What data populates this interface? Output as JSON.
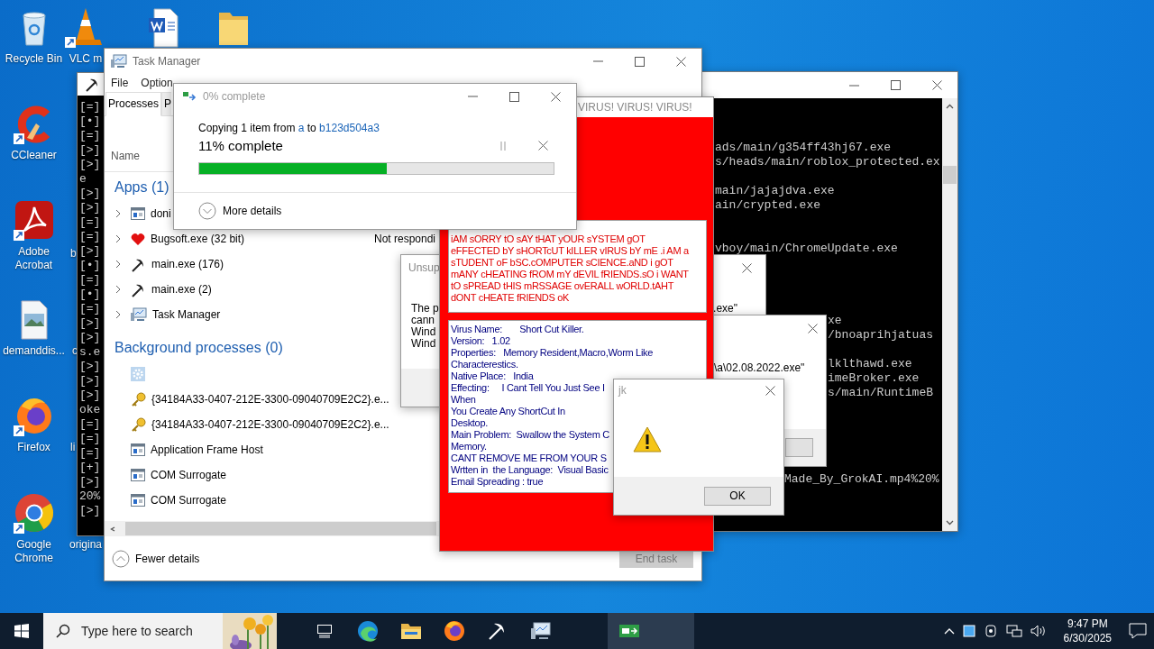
{
  "desktop": {
    "icons": [
      {
        "kind": "recycle-bin",
        "label": "Recycle Bin"
      },
      {
        "kind": "vlc",
        "label": "VLC m"
      },
      {
        "kind": "word-document"
      },
      {
        "kind": "folder"
      },
      {
        "kind": "ccleaner",
        "label": "CCleaner"
      },
      {
        "kind": "acrobat",
        "label": "Adobe Acrobat"
      },
      {
        "kind": "image-file",
        "label": "demanddis..."
      },
      {
        "kind": "firefox",
        "label": "Firefox"
      },
      {
        "kind": "chrome",
        "label": "Google Chrome"
      }
    ],
    "partial_labels": [
      "b",
      "c",
      "li",
      "origina"
    ]
  },
  "left_console": {
    "lines": [
      "[=]",
      "[•]",
      "[=]",
      "[>]",
      "[>]",
      "e",
      "[>]",
      "[>]",
      "[=]",
      "[=]",
      "[>]",
      "[•]",
      "[=]",
      "[•]",
      "[=]",
      "[>]",
      "[>]",
      "s.e",
      "[>]",
      "[>]",
      "[>]",
      "oke",
      "[=]",
      "[=]",
      "[=]",
      "[+]",
      "[>]",
      "20%",
      "[>]"
    ]
  },
  "right_console": {
    "lines": [
      "ads/main/g354ff43hj67.exe",
      "s/heads/main/roblox_protected.ex",
      "main/jajajdva.exe",
      "ain/crypted.exe",
      "vboy/main/ChromeUpdate.exe",
      "xe",
      "/bnoaprihjatuas",
      "lklthawd.exe",
      "imeBroker.exe",
      "s/main/RuntimeB",
      "Made_By_GrokAI.mp4%20%"
    ]
  },
  "task_manager": {
    "title": "Task Manager",
    "menu": [
      "File",
      "Option"
    ],
    "tabs": [
      {
        "label": "Processes",
        "selected": true
      },
      {
        "label": "P",
        "selected": false
      }
    ],
    "column": "Name",
    "groups": [
      {
        "title": "Apps (1)",
        "rows": [
          {
            "kind": "window",
            "name": "doni",
            "expandable": true
          },
          {
            "kind": "heart",
            "name": "Bugsoft.exe (32 bit)",
            "expandable": true,
            "status": "Not respondi"
          },
          {
            "kind": "pickaxe",
            "name": "main.exe (176)",
            "expandable": true
          },
          {
            "kind": "pickaxe",
            "name": "main.exe (2)",
            "expandable": true
          },
          {
            "kind": "monitor",
            "name": "Task Manager",
            "expandable": true
          }
        ]
      },
      {
        "title": "Background processes (0)",
        "rows": [
          {
            "kind": "gear",
            "expandable": false
          },
          {
            "kind": "key",
            "name": "{34184A33-0407-212E-3300-09040709E2C2}.e...",
            "expandable": false
          },
          {
            "kind": "key",
            "name": "{34184A33-0407-212E-3300-09040709E2C2}.e...",
            "expandable": false
          },
          {
            "kind": "window",
            "name": "Application Frame Host",
            "expandable": false
          },
          {
            "kind": "window",
            "name": "COM Surrogate",
            "expandable": false
          },
          {
            "kind": "window",
            "name": "COM Surrogate",
            "expandable": false
          }
        ]
      }
    ],
    "footer": "Fewer details",
    "end_task": {
      "label": "End task",
      "disabled": true
    }
  },
  "copy_dialog": {
    "title": "0% complete",
    "prefix": "Copying 1 item from",
    "source": "a",
    "middle": "to",
    "destination": "b123d504a3",
    "progress_text": "11% complete",
    "level": 0.53,
    "more": "More details"
  },
  "error_dialog": {
    "title": "Unsup",
    "lines": [
      "The p",
      "cann",
      "Wind",
      "Wind"
    ],
    "path_end": ".exe\""
  },
  "error_dialog_2": {
    "path_end": "\\a\\02.08.2022.exe\""
  },
  "virus_window": {
    "title": "VIRUS! VIRUS! VIRUS!",
    "message": [
      "iAM sORRY tO sAY tHAT yOUR sYSTEM gOT",
      "eFFECTED bY sHORTcUT kILLER vIRUS bY mE .i AM a",
      "sTUDENT oF bSC.cOMPUTER sCIENCE.aND i gOT",
      "mANY cHEATING fROM mY dEVIL fRIENDS.sO i WANT",
      "tO sPREAD tHIS mRSSAGE ovERALL wORLD.tAHT",
      "dONT cHEATE fRIENDS oK"
    ],
    "details": [
      "Virus Name:       Short Cut Killer.",
      "Version:   1.02",
      "Properties:   Memory Resident,Macro,Worm Like",
      "Characterestics.",
      "Native Place:   India",
      "Effecting:     I Cant Tell You Just See I",
      "When",
      "You Create Any ShortCut In",
      "Desktop.",
      "Main Problem:  Swallow the System C",
      "Memory.",
      "CANT REMOVE ME FROM YOUR S",
      "Wrtten in  the Language:  Visual Basic",
      "Email Spreading : true"
    ]
  },
  "alert_dialog": {
    "title": "jk",
    "button": "OK"
  },
  "taskbar": {
    "search": {
      "placeholder": "Type here to search"
    },
    "apps": [
      {
        "kind": "task-view",
        "active": false
      },
      {
        "kind": "edge",
        "active": false
      },
      {
        "kind": "explorer",
        "active": false
      },
      {
        "kind": "firefox",
        "active": false
      },
      {
        "kind": "pickaxe",
        "active": false
      },
      {
        "kind": "monitor",
        "active": false
      },
      {
        "kind": "copy",
        "active": true
      },
      {
        "kind": "blank",
        "active": true
      }
    ],
    "time": "9:47 PM",
    "date": "6/30/2025"
  }
}
